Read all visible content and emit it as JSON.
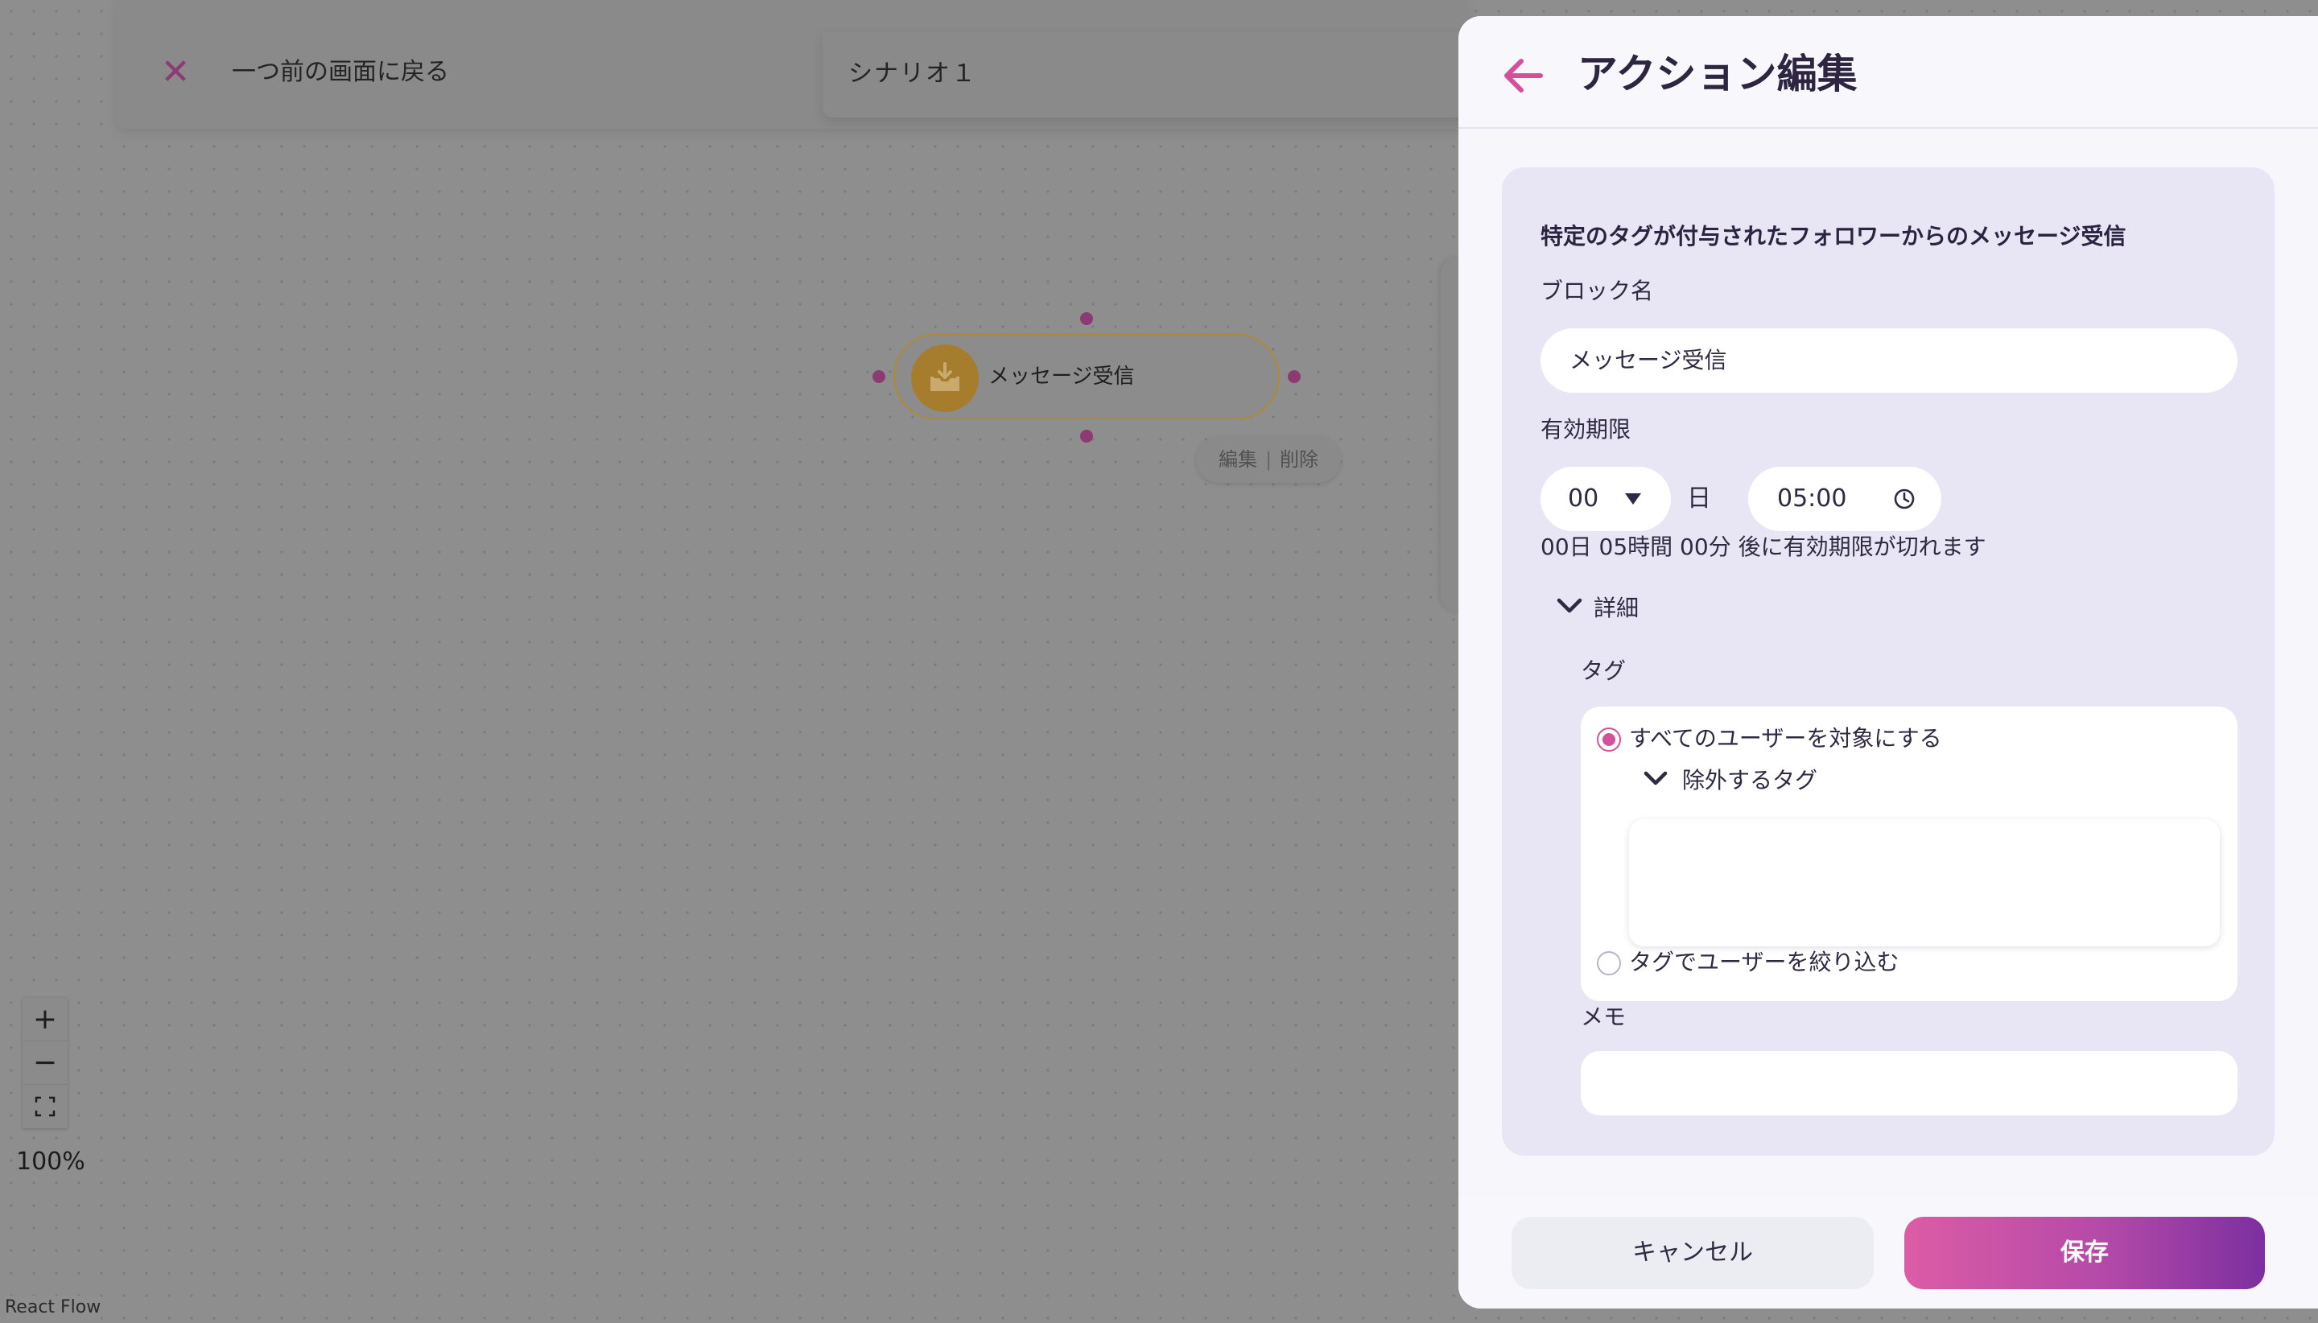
{
  "canvas": {
    "back_label": "一つ前の画面に戻る",
    "scenario_title": "シナリオ１",
    "node": {
      "label": "メッセージ受信",
      "icon": "inbox-download-icon"
    },
    "node_actions": {
      "edit": "編集",
      "separator": "|",
      "delete": "削除"
    },
    "controls": {
      "zoom_in": "+",
      "zoom_out": "−",
      "fit_view": "⛶"
    },
    "zoom_level": "100%",
    "attribution": "React Flow"
  },
  "drawer": {
    "title": "アクション編集",
    "card_heading": "特定のタグが付与されたフォロワーからのメッセージ受信",
    "block_name": {
      "label": "ブロック名",
      "value": "メッセージ受信"
    },
    "expiry": {
      "label": "有効期限",
      "days_value": "00",
      "days_unit": "日",
      "time_value": "05:00",
      "summary": "00日 05時間 00分 後に有効期限が切れます"
    },
    "details": {
      "toggle_label": "詳細",
      "tag_label": "タグ",
      "option_all": "すべてのユーザーを対象にする",
      "exclude_label": "除外するタグ",
      "option_filter": "タグでユーザーを絞り込む",
      "memo_label": "メモ",
      "memo_value": ""
    },
    "footer": {
      "cancel": "キャンセル",
      "save": "保存"
    }
  },
  "colors": {
    "accent_pink": "#d4509a",
    "save_gradient_start": "#dc5ca6",
    "save_gradient_end": "#7c2fa0",
    "node_border": "#ad8a36",
    "overlay": "#8e8e8e"
  }
}
